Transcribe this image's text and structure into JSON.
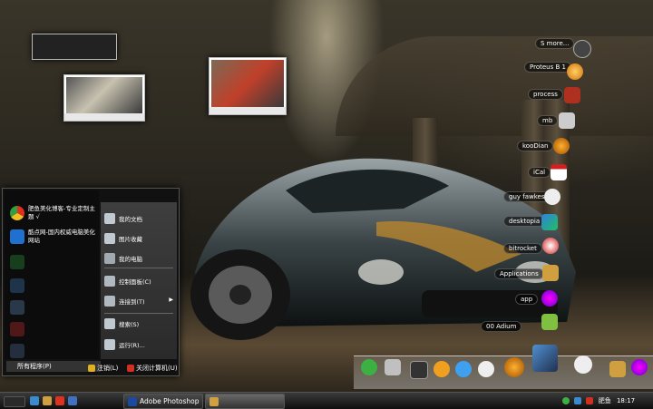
{
  "desktop": {
    "dock_labels": [
      "S more...",
      "Proteus B 1",
      "process",
      "mb",
      "kooDian",
      "iCal",
      "guy fawkes",
      "desktopia",
      "bitrocket",
      "Applications",
      "app"
    ],
    "adium_label": "00 Adium"
  },
  "start_menu": {
    "pinned": [
      {
        "label": "肥鱼美化博客-专业定制主题 √",
        "icon": "chrome-icon"
      },
      {
        "label": "酷点网-国内权威电脑美化网站",
        "icon": "ie-icon"
      }
    ],
    "right_items": [
      {
        "label": "我的文档",
        "icon": "documents-icon"
      },
      {
        "label": "图片收藏",
        "icon": "pictures-icon"
      },
      {
        "label": "我的电脑",
        "icon": "computer-icon"
      },
      {
        "label": "控制面板(C)",
        "icon": "control-panel-icon"
      },
      {
        "label": "连接到(T)",
        "icon": "network-icon"
      },
      {
        "label": "搜索(S)",
        "icon": "search-icon"
      },
      {
        "label": "运行(R)...",
        "icon": "run-icon"
      }
    ],
    "all_programs": "所有程序(P)",
    "logoff": "注销(L)",
    "shutdown": "关闭计算机(U)"
  },
  "taskbar": {
    "tasks": [
      {
        "label": "Adobe Photoshop",
        "icon": "photoshop-icon"
      },
      {
        "label": "",
        "icon": "folder-icon"
      }
    ],
    "tray": {
      "text": "肥鱼",
      "time": "18:17"
    }
  },
  "colors": {
    "accent": "#f0a020"
  }
}
